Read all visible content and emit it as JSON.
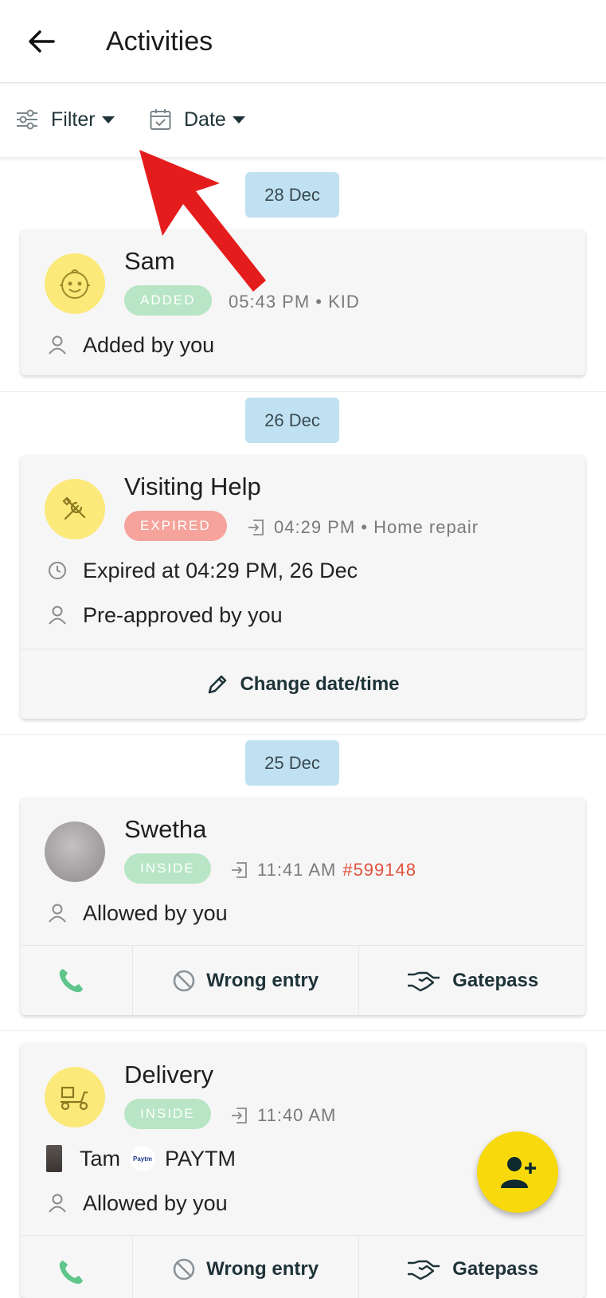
{
  "header": {
    "title": "Activities"
  },
  "filters": {
    "filter_label": "Filter",
    "date_label": "Date"
  },
  "groups": [
    {
      "date": "28 Dec",
      "card": {
        "name": "Sam",
        "badge": "ADDED",
        "meta": "05:43 PM • KID",
        "by": "Added by you"
      }
    },
    {
      "date": "26 Dec",
      "card": {
        "name": "Visiting Help",
        "badge": "EXPIRED",
        "meta": "04:29 PM • Home repair",
        "expired": "Expired at 04:29 PM, 26 Dec",
        "by": "Pre-approved by you",
        "action": "Change date/time"
      }
    },
    {
      "date": "25 Dec",
      "cards": [
        {
          "name": "Swetha",
          "badge": "INSIDE",
          "meta": "11:41 AM",
          "pass": "#599148",
          "by": "Allowed by you",
          "wrong": "Wrong entry",
          "gatepass": "Gatepass"
        },
        {
          "name": "Delivery",
          "badge": "INSIDE",
          "meta": "11:40 AM",
          "person": "Tam",
          "company": "PAYTM",
          "company_logo": "Paytm",
          "by": "Allowed by you",
          "wrong": "Wrong entry",
          "gatepass": "Gatepass"
        }
      ]
    }
  ],
  "icons": [
    "back-arrow-icon",
    "filter-sliders-icon",
    "calendar-icon",
    "baby-face-icon",
    "tools-icon",
    "entry-icon",
    "clock-icon",
    "person-icon",
    "pencil-icon",
    "phone-icon",
    "block-icon",
    "handshake-icon",
    "add-user-icon"
  ],
  "colors": {
    "accent_yellow": "#f7d90c",
    "date_chip": "#bfe1f2",
    "inside": "#b7e5c5",
    "expired": "#f5a39b",
    "pass_number": "#e0513c",
    "annotation_arrow": "#e51c1c"
  }
}
